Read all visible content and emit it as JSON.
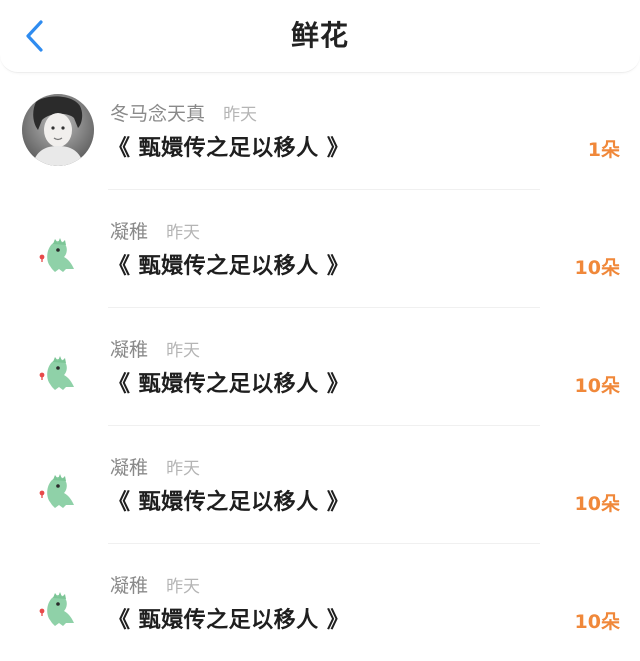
{
  "header": {
    "title": "鲜花",
    "back_icon": "chevron-left-icon",
    "accent_color": "#2f8cf0"
  },
  "items": [
    {
      "name": "冬马念天真",
      "time": "昨天",
      "title": "《 甄嬛传之足以移人 》",
      "count": "1朵",
      "avatar": "photo-avatar"
    },
    {
      "name": "凝稚",
      "time": "昨天",
      "title": "《 甄嬛传之足以移人 》",
      "count": "10朵",
      "avatar": "dinosaur-avatar"
    },
    {
      "name": "凝稚",
      "time": "昨天",
      "title": "《 甄嬛传之足以移人 》",
      "count": "10朵",
      "avatar": "dinosaur-avatar"
    },
    {
      "name": "凝稚",
      "time": "昨天",
      "title": "《 甄嬛传之足以移人 》",
      "count": "10朵",
      "avatar": "dinosaur-avatar"
    },
    {
      "name": "凝稚",
      "time": "昨天",
      "title": "《 甄嬛传之足以移人 》",
      "count": "10朵",
      "avatar": "dinosaur-avatar"
    }
  ],
  "colors": {
    "count": "#f0883a",
    "name": "#8a8a8a",
    "time": "#b5b5b5",
    "dino": "#8fd1a8"
  }
}
